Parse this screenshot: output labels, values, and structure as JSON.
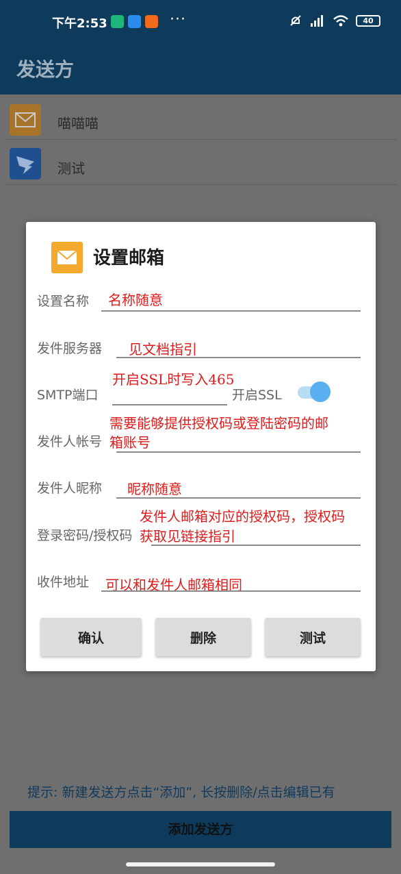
{
  "status": {
    "time": "下午2:53",
    "dots": "···",
    "battery": "40"
  },
  "appbar": {
    "title": "发送方"
  },
  "senders": [
    {
      "label": "喵喵喵",
      "icon": "mail-icon",
      "color": "#f3a92d"
    },
    {
      "label": "测试",
      "icon": "dingtalk-icon",
      "color": "#1f6fd1"
    }
  ],
  "dialog": {
    "title": "设置邮箱",
    "fields": {
      "name": {
        "label": "设置名称",
        "value": "名称随意"
      },
      "server": {
        "label": "发件服务器",
        "value": "见文档指引"
      },
      "port": {
        "label": "SMTP端口",
        "note": "开启SSL时写入465",
        "value": ""
      },
      "ssl": {
        "label": "开启SSL",
        "enabled": true
      },
      "account": {
        "label": "发件人帐号",
        "value_line1": "需要能够提供授权码或登陆密码的邮",
        "value_line2": "箱账号"
      },
      "nickname": {
        "label": "发件人昵称",
        "value": "昵称随意"
      },
      "password": {
        "label": "登录密码/授权码",
        "value_line1": "发件人邮箱对应的授权码，授权码",
        "value_line2": "获取见链接指引"
      },
      "recipient": {
        "label": "收件地址",
        "value": "可以和发件人邮箱相同"
      }
    },
    "buttons": {
      "confirm": "确认",
      "delete": "删除",
      "test": "测试"
    }
  },
  "hint": "提示: 新建发送方点击“添加”, 长按删除/点击编辑已有",
  "add_button": "添加发送方",
  "colors": {
    "primary": "#0e3a5c",
    "accent": "#5aaff0",
    "annotation": "#e01b1b"
  }
}
